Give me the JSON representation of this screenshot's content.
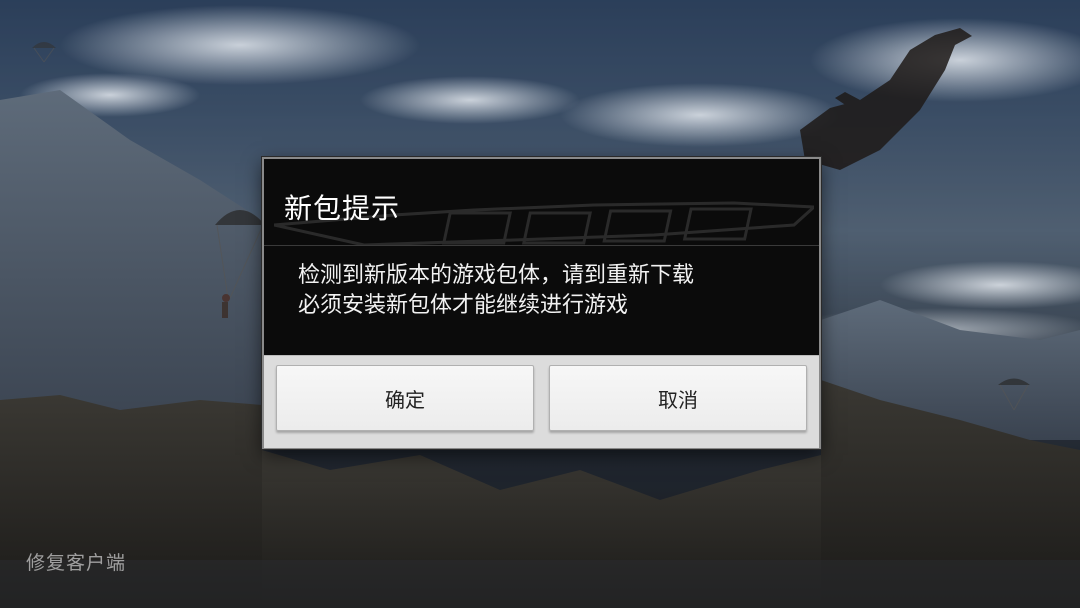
{
  "background": {
    "description_icon": "parachute-landscape-background",
    "repair_client_label": "修复客户端"
  },
  "dialog": {
    "title": "新包提示",
    "message_lines": [
      "检测到新版本的游戏包体，请到重新下载",
      "必须安装新包体才能继续进行游戏"
    ],
    "confirm_label": "确定",
    "cancel_label": "取消"
  },
  "colors": {
    "dialog_bg": "#0b0b0b",
    "dialog_border": "#8a8a8a",
    "button_bar_bg": "#dcdcdc",
    "button_bg": "#f2f2f2",
    "text_light": "#ffffff",
    "text_dark": "#222222"
  }
}
